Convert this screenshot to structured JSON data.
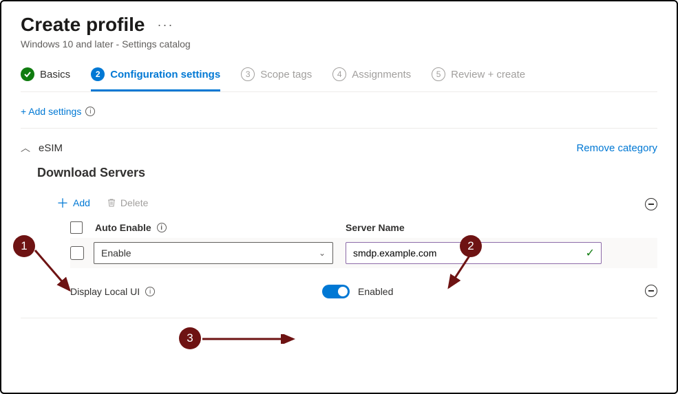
{
  "header": {
    "title": "Create profile",
    "subtitle": "Windows 10 and later - Settings catalog"
  },
  "steps": [
    {
      "label": "Basics",
      "state": "done"
    },
    {
      "num": "2",
      "label": "Configuration settings",
      "state": "active"
    },
    {
      "num": "3",
      "label": "Scope tags",
      "state": "pending"
    },
    {
      "num": "4",
      "label": "Assignments",
      "state": "pending"
    },
    {
      "num": "5",
      "label": "Review + create",
      "state": "pending"
    }
  ],
  "actions": {
    "add_settings": "+ Add settings",
    "remove_category": "Remove category"
  },
  "category": {
    "name": "eSIM",
    "section_title": "Download Servers",
    "toolbar": {
      "add": "Add",
      "delete": "Delete"
    },
    "columns": {
      "auto_enable": "Auto Enable",
      "server_name": "Server Name"
    },
    "row": {
      "auto_enable_value": "Enable",
      "server_name_value": "smdp.example.com"
    },
    "display_local_ui": {
      "label": "Display Local UI",
      "state_label": "Enabled",
      "enabled": true
    }
  },
  "annotations": {
    "a1": "1",
    "a2": "2",
    "a3": "3"
  }
}
